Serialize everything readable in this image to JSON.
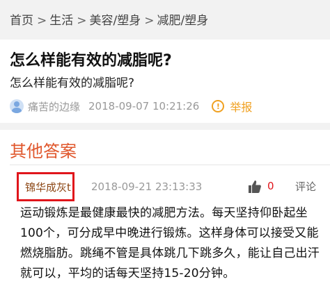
{
  "breadcrumb": {
    "items": [
      "首页",
      "生活",
      "美容/塑身",
      "减肥/塑身"
    ],
    "separator": ">"
  },
  "question": {
    "title": "怎么样能有效的减脂呢?",
    "body": "怎么样能有效的减脂呢?",
    "author": "痛苦的边缘",
    "datetime": "2018-09-07 10:21:26",
    "report_label": "举报",
    "icons": {
      "author": "user-avatar-icon",
      "report": "warning-icon"
    }
  },
  "answers": {
    "heading": "其他答案",
    "items": [
      {
        "author": "锦华成灰t",
        "datetime": "2018-09-21 23:13:33",
        "likes": "0",
        "comment_label": "评论",
        "body": "运动锻炼是最健康最快的减肥方法。每天坚持仰卧起坐100个，可分成早中晚进行锻炼。这样身体可以接受又能燃烧脂肪。跳绳不管是具体跳几下跳多久，能让自己出汗就可以，平均的话每天坚持15-20分钟。"
      }
    ]
  },
  "colors": {
    "accent_orange": "#e0562b",
    "highlight_red": "#e0151b",
    "report_orange": "#f0a020",
    "author_brown": "#8b4513",
    "breadcrumb_bg": "#f2f2f2"
  }
}
